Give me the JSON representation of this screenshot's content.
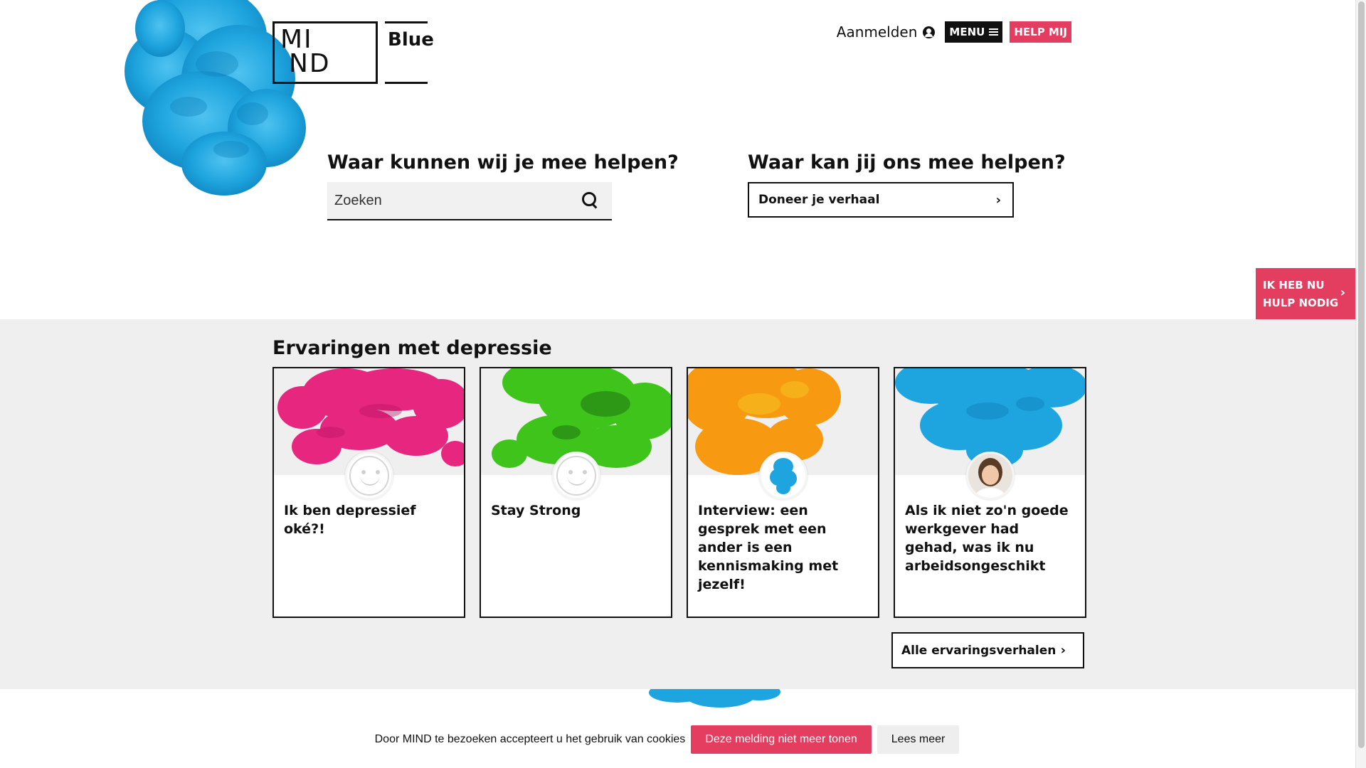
{
  "header": {
    "logo_top": "MI",
    "logo_bottom": "ND",
    "logo_suffix": "Blue",
    "login_label": "Aanmelden",
    "menu_label": "MENU",
    "help_label": "HELP MIJ"
  },
  "hero": {
    "left_title": "Waar kunnen wij je mee helpen?",
    "search_placeholder": "Zoeken",
    "right_title": "Waar kan jij ons mee helpen?",
    "donate_label": "Doneer je verhaal"
  },
  "side_tab": {
    "line1": "IK HEB NU",
    "line2": "HULP NODIG"
  },
  "experiences": {
    "title": "Ervaringen met depressie",
    "cards": [
      {
        "title": "Ik ben depressief oké?!",
        "ink_color": "#e6267f",
        "avatar": "smiley"
      },
      {
        "title": "Stay Strong",
        "ink_color": "#3ec41b",
        "avatar": "smiley"
      },
      {
        "title": "Interview: een gesprek met een ander is een kennismaking met jezelf!",
        "ink_color": "#f79a12",
        "avatar": "blue-ink"
      },
      {
        "title": "Als ik niet zo'n goede werkgever had gehad, was ik nu arbeidsongeschikt",
        "ink_color": "#1aa1dd",
        "avatar": "photo"
      }
    ],
    "all_label": "Alle ervaringsverhalen"
  },
  "cookie": {
    "text": "Door MIND te bezoeken accepteert u het gebruik van cookies",
    "accept_label": "Deze melding niet meer tonen",
    "more_label": "Lees meer"
  },
  "colors": {
    "accent": "#e33e5f",
    "ink_blue": "#1aa1dd",
    "section_bg": "#efefef"
  }
}
